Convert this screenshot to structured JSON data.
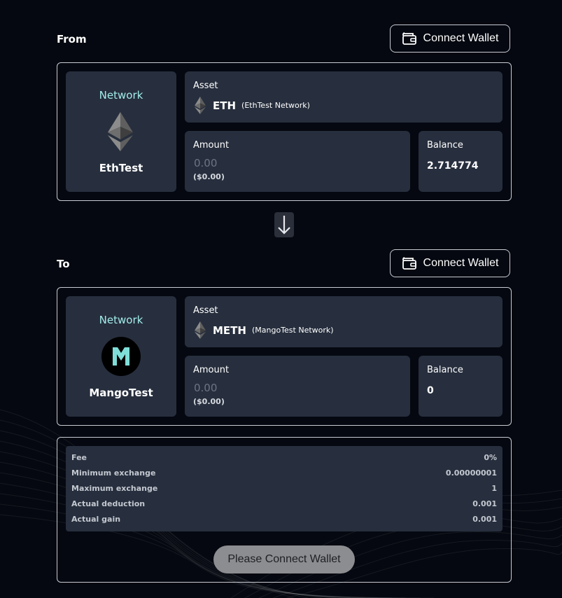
{
  "from": {
    "label": "From",
    "connect_wallet": "Connect Wallet",
    "network_title": "Network",
    "network_name": "EthTest",
    "asset_label": "Asset",
    "asset_symbol": "ETH",
    "asset_network": "(EthTest Network)",
    "amount_label": "Amount",
    "amount_placeholder": "0.00",
    "amount_usd": "($0.00)",
    "balance_label": "Balance",
    "balance_value": "2.714774"
  },
  "to": {
    "label": "To",
    "connect_wallet": "Connect Wallet",
    "network_title": "Network",
    "network_name": "MangoTest",
    "asset_label": "Asset",
    "asset_symbol": "METH",
    "asset_network": "(MangoTest Network)",
    "amount_label": "Amount",
    "amount_placeholder": "0.00",
    "amount_usd": "($0.00)",
    "balance_label": "Balance",
    "balance_value": "0"
  },
  "details": [
    {
      "label": "Fee",
      "value": "0%"
    },
    {
      "label": "Minimum exchange",
      "value": "0.00000001"
    },
    {
      "label": "Maximum exchange",
      "value": "1"
    },
    {
      "label": "Actual deduction",
      "value": "0.001"
    },
    {
      "label": "Actual gain",
      "value": "0.001"
    }
  ],
  "submit_label": "Please Connect Wallet",
  "colors": {
    "background": "#050810",
    "tile": "#272f3e",
    "network_title": "#a3ecea",
    "mango_logo": "#7fded8"
  },
  "icons": {
    "wallet": "wallet-icon",
    "eth": "ethereum-icon",
    "mango": "mango-logo",
    "swap": "arrow-down-icon"
  }
}
